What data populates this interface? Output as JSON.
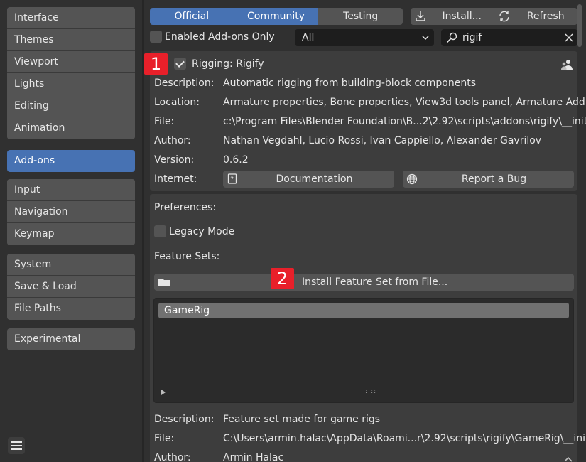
{
  "sidebar": {
    "group1": [
      "Interface",
      "Themes",
      "Viewport",
      "Lights",
      "Editing",
      "Animation"
    ],
    "group2": [
      "Add-ons"
    ],
    "group3": [
      "Input",
      "Navigation",
      "Keymap"
    ],
    "group4": [
      "System",
      "Save & Load",
      "File Paths"
    ],
    "group5": [
      "Experimental"
    ],
    "active": "Add-ons",
    "menu_icon": "hamburger-icon"
  },
  "toolbar": {
    "tabs": [
      {
        "label": "Official",
        "active": true
      },
      {
        "label": "Community",
        "active": true
      },
      {
        "label": "Testing",
        "active": false
      }
    ],
    "install_label": "Install...",
    "refresh_label": "Refresh",
    "enabled_only_label": "Enabled Add-ons Only",
    "enabled_only_checked": false,
    "category_value": "All",
    "search_value": "rigif"
  },
  "addon": {
    "name": "Rigging: Rigify",
    "enabled": true,
    "description_key": "Description:",
    "description": "Automatic rigging from building-block components",
    "location_key": "Location:",
    "location": "Armature properties, Bone properties, View3d tools panel, Armature Add m...",
    "file_key": "File:",
    "file": "c:\\Program Files\\Blender Foundation\\B...2\\2.92\\scripts\\addons\\rigify\\__init__.py",
    "author_key": "Author:",
    "author": "Nathan Vegdahl, Lucio Rossi, Ivan Cappiello, Alexander Gavrilov",
    "version_key": "Version:",
    "version": "0.6.2",
    "internet_key": "Internet:",
    "documentation_label": "Documentation",
    "report_bug_label": "Report a Bug"
  },
  "preferences": {
    "title": "Preferences:",
    "legacy_mode_label": "Legacy Mode",
    "legacy_mode_checked": false,
    "feature_sets_label": "Feature Sets:",
    "install_feature_set_label": "Install Feature Set from File...",
    "feature_sets": [
      "GameRig"
    ],
    "fs_description_key": "Description:",
    "fs_description": "Feature set made for game rigs",
    "fs_file_key": "File:",
    "fs_file": "C:\\Users\\armin.halac\\AppData\\Roami...r\\2.92\\scripts\\rigify\\GameRig\\__init__.py",
    "fs_author_key": "Author:",
    "fs_author": "Armin Halac"
  },
  "markers": [
    "1",
    "2"
  ],
  "colors": {
    "accent": "#4772b3",
    "marker": "#e8202a",
    "panel": "#3d3d3d",
    "background": "#303030"
  }
}
